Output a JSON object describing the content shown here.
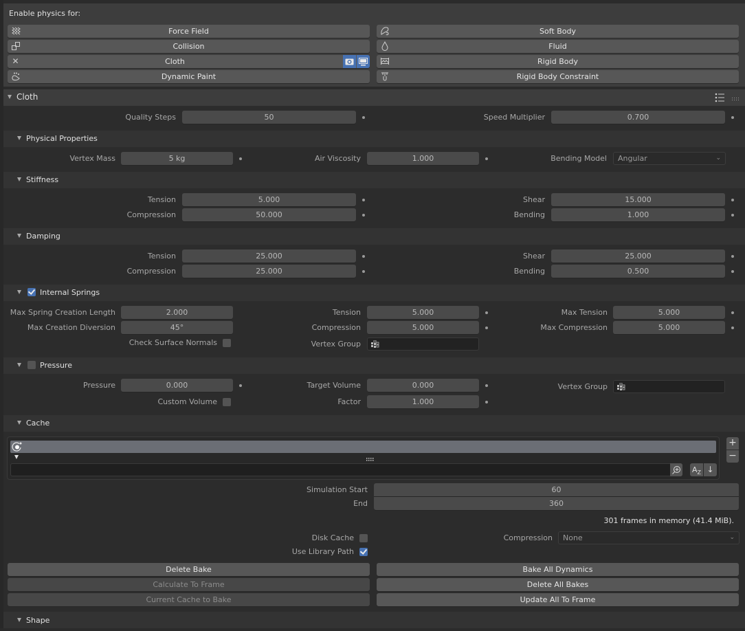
{
  "enable_physics": {
    "label": "Enable physics for:",
    "left": [
      {
        "label": "Force Field",
        "icon": "force-field-icon"
      },
      {
        "label": "Collision",
        "icon": "collision-icon"
      },
      {
        "label": "Cloth",
        "icon": "close-icon"
      },
      {
        "label": "Dynamic Paint",
        "icon": "dynamic-paint-icon"
      }
    ],
    "right": [
      {
        "label": "Soft Body",
        "icon": "soft-body-icon"
      },
      {
        "label": "Fluid",
        "icon": "fluid-icon"
      },
      {
        "label": "Rigid Body",
        "icon": "rigid-body-icon"
      },
      {
        "label": "Rigid Body Constraint",
        "icon": "rigid-body-constraint-icon"
      }
    ]
  },
  "cloth": {
    "title": "Cloth",
    "quality_steps": {
      "label": "Quality Steps",
      "value": "50"
    },
    "speed_multiplier": {
      "label": "Speed Multiplier",
      "value": "0.700"
    }
  },
  "physical_properties": {
    "title": "Physical Properties",
    "vertex_mass": {
      "label": "Vertex Mass",
      "value": "5 kg"
    },
    "air_viscosity": {
      "label": "Air Viscosity",
      "value": "1.000"
    },
    "bending_model": {
      "label": "Bending Model",
      "value": "Angular"
    }
  },
  "stiffness": {
    "title": "Stiffness",
    "tension": {
      "label": "Tension",
      "value": "5.000"
    },
    "compression": {
      "label": "Compression",
      "value": "50.000"
    },
    "shear": {
      "label": "Shear",
      "value": "15.000"
    },
    "bending": {
      "label": "Bending",
      "value": "1.000"
    }
  },
  "damping": {
    "title": "Damping",
    "tension": {
      "label": "Tension",
      "value": "25.000"
    },
    "compression": {
      "label": "Compression",
      "value": "25.000"
    },
    "shear": {
      "label": "Shear",
      "value": "25.000"
    },
    "bending": {
      "label": "Bending",
      "value": "0.500"
    }
  },
  "internal_springs": {
    "title": "Internal Springs",
    "enabled": true,
    "max_spring_length": {
      "label": "Max Spring Creation Length",
      "value": "2.000"
    },
    "max_diversion": {
      "label": "Max Creation Diversion",
      "value": "45°"
    },
    "check_normals": {
      "label": "Check Surface Normals",
      "checked": false
    },
    "tension": {
      "label": "Tension",
      "value": "5.000"
    },
    "compression": {
      "label": "Compression",
      "value": "5.000"
    },
    "vertex_group": {
      "label": "Vertex Group",
      "value": ""
    },
    "max_tension": {
      "label": "Max Tension",
      "value": "5.000"
    },
    "max_compression": {
      "label": "Max Compression",
      "value": "5.000"
    }
  },
  "pressure": {
    "title": "Pressure",
    "enabled": false,
    "pressure": {
      "label": "Pressure",
      "value": "0.000"
    },
    "custom_volume": {
      "label": "Custom Volume",
      "checked": false
    },
    "target_volume": {
      "label": "Target Volume",
      "value": "0.000"
    },
    "factor": {
      "label": "Factor",
      "value": "1.000"
    },
    "vertex_group": {
      "label": "Vertex Group",
      "value": ""
    }
  },
  "cache": {
    "title": "Cache",
    "list_item": "",
    "filter_value": "",
    "simulation_start": {
      "label": "Simulation Start",
      "value": "60"
    },
    "end": {
      "label": "End",
      "value": "360"
    },
    "info": "301 frames in memory (41.4 MiB).",
    "disk_cache": {
      "label": "Disk Cache",
      "checked": false
    },
    "use_library_path": {
      "label": "Use Library Path",
      "checked": true
    },
    "compression": {
      "label": "Compression",
      "value": "None"
    },
    "buttons_left": [
      "Delete Bake",
      "Calculate To Frame",
      "Current Cache to Bake"
    ],
    "buttons_right": [
      "Bake All Dynamics",
      "Delete All Bakes",
      "Update All To Frame"
    ]
  },
  "shape": {
    "title": "Shape"
  },
  "colors": {
    "accent": "#4772b3",
    "panel_bg": "#2c2c2c",
    "header_bg": "#3d3d3d",
    "button_bg": "#575757"
  }
}
